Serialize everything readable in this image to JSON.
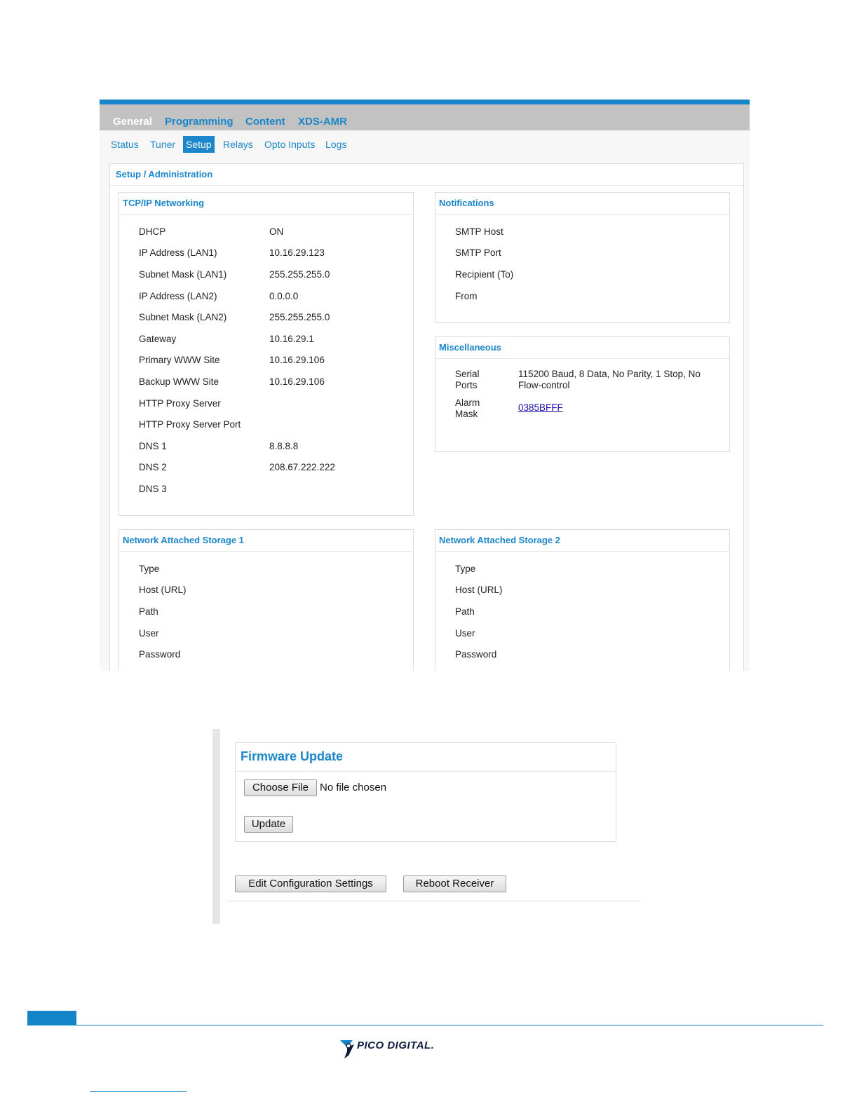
{
  "main_nav": [
    "General",
    "Programming",
    "Content",
    "XDS-AMR"
  ],
  "sub_nav": [
    "Status",
    "Tuner",
    "Setup",
    "Relays",
    "Opto Inputs",
    "Logs"
  ],
  "setup_title": "Setup / Administration",
  "tcpip": {
    "title": "TCP/IP Networking",
    "rows": [
      {
        "label": "DHCP",
        "value": "ON"
      },
      {
        "label": "IP Address (LAN1)",
        "value": "10.16.29.123"
      },
      {
        "label": "Subnet Mask (LAN1)",
        "value": "255.255.255.0"
      },
      {
        "label": "IP Address (LAN2)",
        "value": "0.0.0.0"
      },
      {
        "label": "Subnet Mask (LAN2)",
        "value": "255.255.255.0"
      },
      {
        "label": "Gateway",
        "value": "10.16.29.1"
      },
      {
        "label": "Primary WWW Site",
        "value": "10.16.29.106"
      },
      {
        "label": "Backup WWW Site",
        "value": "10.16.29.106"
      },
      {
        "label": "HTTP Proxy Server",
        "value": ""
      },
      {
        "label": "HTTP Proxy Server Port",
        "value": ""
      },
      {
        "label": "DNS 1",
        "value": "8.8.8.8"
      },
      {
        "label": "DNS 2",
        "value": "208.67.222.222"
      },
      {
        "label": "DNS 3",
        "value": ""
      }
    ]
  },
  "notifications": {
    "title": "Notifications",
    "rows": [
      "SMTP Host",
      "SMTP Port",
      "Recipient (To)",
      "From"
    ]
  },
  "misc": {
    "title": "Miscellaneous",
    "serial_label_1": "Serial",
    "serial_label_2": "Ports",
    "serial_value_1": "115200 Baud, 8 Data, No Parity, 1 Stop, No",
    "serial_value_2": "Flow-control",
    "alarm_label_1": "Alarm",
    "alarm_label_2": "Mask",
    "alarm_value": "0385BFFF"
  },
  "nas1": {
    "title": "Network Attached Storage 1",
    "rows": [
      "Type",
      "Host (URL)",
      "Path",
      "User",
      "Password"
    ]
  },
  "nas2": {
    "title": "Network Attached Storage 2",
    "rows": [
      "Type",
      "Host (URL)",
      "Path",
      "User",
      "Password"
    ]
  },
  "firmware": {
    "title": "Firmware Update",
    "choose_file": "Choose File",
    "file_status": "No file chosen",
    "update": "Update"
  },
  "actions": {
    "edit_config": "Edit Configuration Settings",
    "reboot": "Reboot Receiver"
  },
  "logo_text": "PICO DIGITAL.",
  "colors": {
    "accent": "#1b86c9",
    "topbar": "#c2c2c2",
    "footer": "#1385c8"
  }
}
